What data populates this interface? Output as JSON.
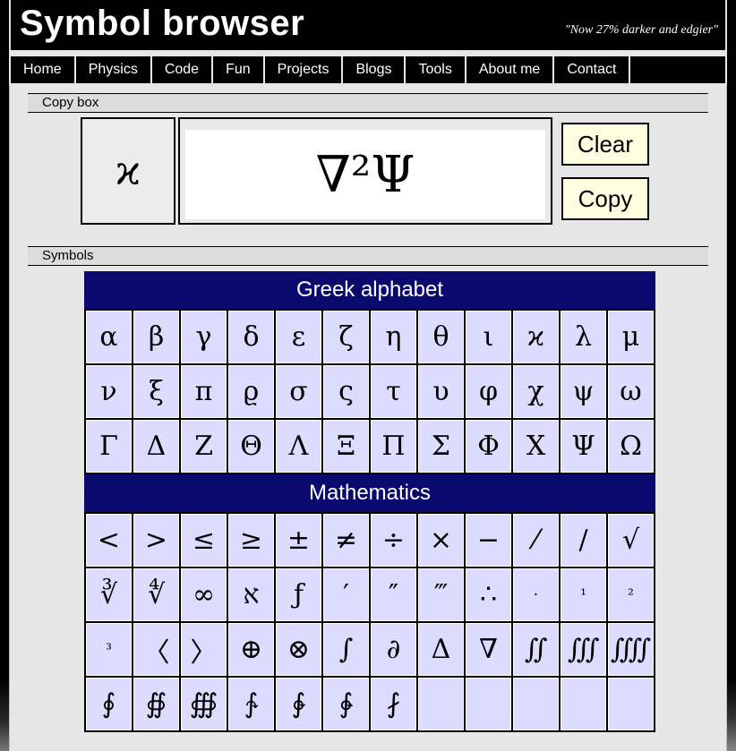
{
  "header": {
    "title": "Symbol browser",
    "tagline": "\"Now 27% darker and edgier\""
  },
  "nav": [
    "Home",
    "Physics",
    "Code",
    "Fun",
    "Projects",
    "Blogs",
    "Tools",
    "About me",
    "Contact"
  ],
  "copy_box": {
    "section_label": "Copy box",
    "current_symbol": "ϰ",
    "field_value": "∇²Ψ",
    "clear_label": "Clear",
    "copy_label": "Copy"
  },
  "symbols": {
    "section_label": "Symbols",
    "categories": [
      {
        "name": "Greek alphabet",
        "symbols": [
          "α",
          "β",
          "γ",
          "δ",
          "ε",
          "ζ",
          "η",
          "θ",
          "ι",
          "ϰ",
          "λ",
          "μ",
          "ν",
          "ξ",
          "π",
          "ϱ",
          "σ",
          "ς",
          "τ",
          "υ",
          "φ",
          "χ",
          "ψ",
          "ω",
          "Γ",
          "Δ",
          "Ζ",
          "Θ",
          "Λ",
          "Ξ",
          "Π",
          "Σ",
          "Φ",
          "Χ",
          "Ψ",
          "Ω"
        ]
      },
      {
        "name": "Mathematics",
        "symbols": [
          "<",
          ">",
          "≤",
          "≥",
          "±",
          "≠",
          "÷",
          "×",
          "−",
          "⁄",
          "∕",
          "√",
          "∛",
          "∜",
          "∞",
          "א",
          "ƒ",
          "′",
          "″",
          "‴",
          "∴",
          "·",
          "¹",
          "²",
          "³",
          "〈",
          "〉",
          "⊕",
          "⊗",
          "∫",
          "∂",
          "Δ",
          "∇",
          "∬",
          "∭",
          "⨌",
          "∮",
          "∯",
          "∰",
          "∱",
          "∲",
          "∳",
          "⨏",
          "",
          "",
          "",
          "",
          ""
        ]
      }
    ]
  }
}
